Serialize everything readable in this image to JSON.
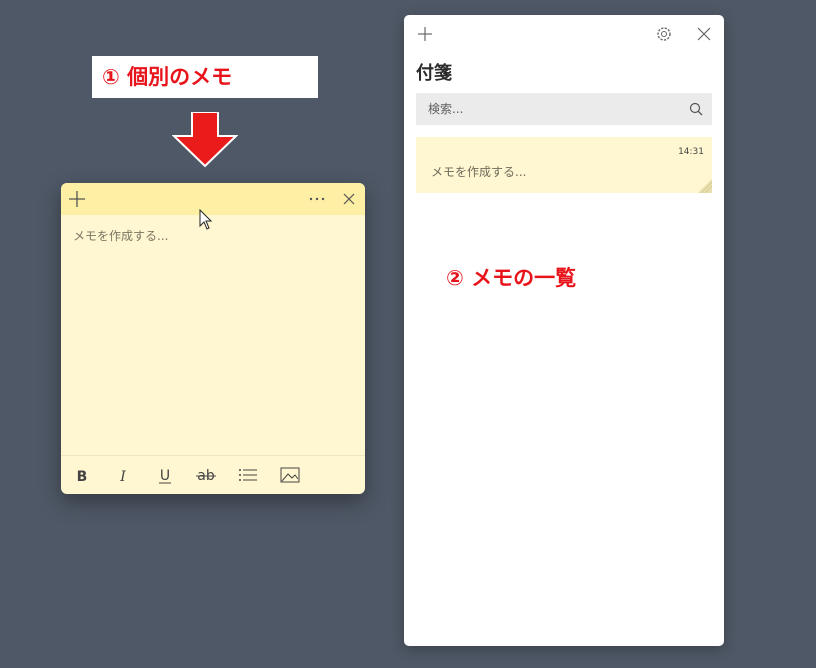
{
  "annotations": {
    "callout1": "① 個別のメモ",
    "callout2": "② メモの一覧"
  },
  "note": {
    "placeholder": "メモを作成する...",
    "toolbar": [
      "bold",
      "italic",
      "underline",
      "strikethrough",
      "bullet-list",
      "image"
    ]
  },
  "panel": {
    "title": "付箋",
    "search_placeholder": "検索...",
    "notes": [
      {
        "time": "14:31",
        "text": "メモを作成する..."
      }
    ]
  },
  "colors": {
    "background": "#4f5866",
    "note_fill": "#fff7d1",
    "note_header": "#fdf0a5",
    "accent_red": "#e8141c"
  }
}
